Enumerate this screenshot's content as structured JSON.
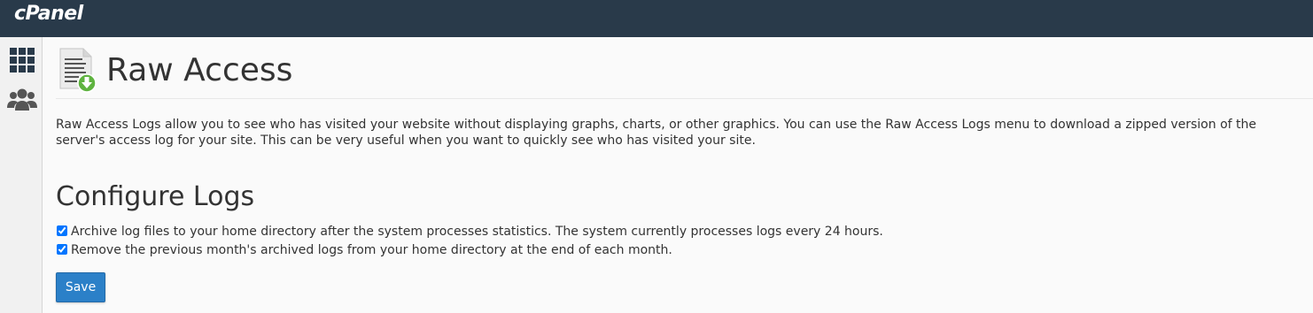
{
  "header": {
    "logo_text": "cPanel"
  },
  "sidebar": {
    "items": [
      {
        "icon": "grid-icon",
        "label": ""
      },
      {
        "icon": "users-icon",
        "label": ""
      }
    ]
  },
  "page": {
    "title": "Raw Access",
    "description": "Raw Access Logs allow you to see who has visited your website without displaying graphs, charts, or other graphics. You can use the Raw Access Logs menu to download a zipped version of the server's access log for your site. This can be very useful when you want to quickly see who has visited your site.",
    "configure": {
      "title": "Configure Logs",
      "options": [
        {
          "label": "Archive log files to your home directory after the system processes statistics. The system currently processes logs every 24 hours.",
          "checked": true
        },
        {
          "label": "Remove the previous month's archived logs from your home directory at the end of each month.",
          "checked": true
        }
      ],
      "save_label": "Save"
    }
  },
  "colors": {
    "topbar": "#293a4a",
    "button": "#2b80c8",
    "download_badge": "#5fb340"
  }
}
